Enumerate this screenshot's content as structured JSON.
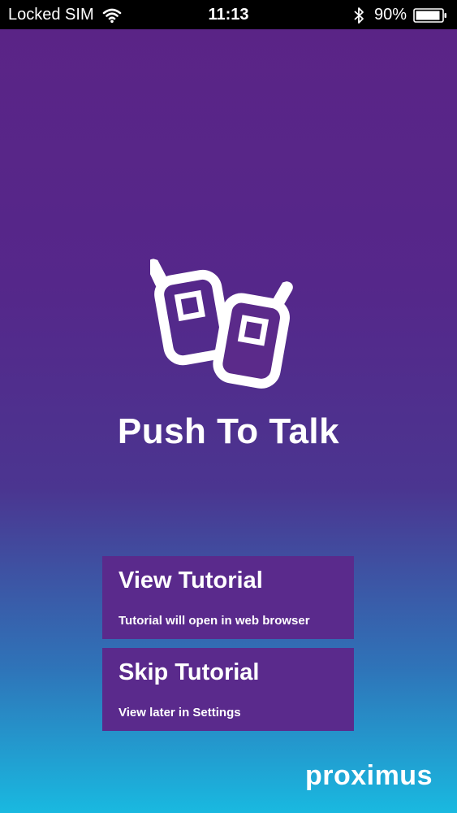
{
  "status_bar": {
    "carrier": "Locked SIM",
    "time": "11:13",
    "battery": "90%",
    "icons": [
      "wifi-icon",
      "bluetooth-icon",
      "battery-icon"
    ]
  },
  "splash": {
    "title": "Push To Talk",
    "logo_icon": "walkie-talkie-icon"
  },
  "options": [
    {
      "title": "View Tutorial",
      "subtitle": "Tutorial will open in web browser"
    },
    {
      "title": "Skip Tutorial",
      "subtitle": "View later in Settings"
    }
  ],
  "brand": {
    "name": "proximus"
  },
  "colors": {
    "background_top": "#5b2486",
    "background_bottom": "#19b9e0",
    "button": "#5a2a8c",
    "text": "#ffffff"
  }
}
